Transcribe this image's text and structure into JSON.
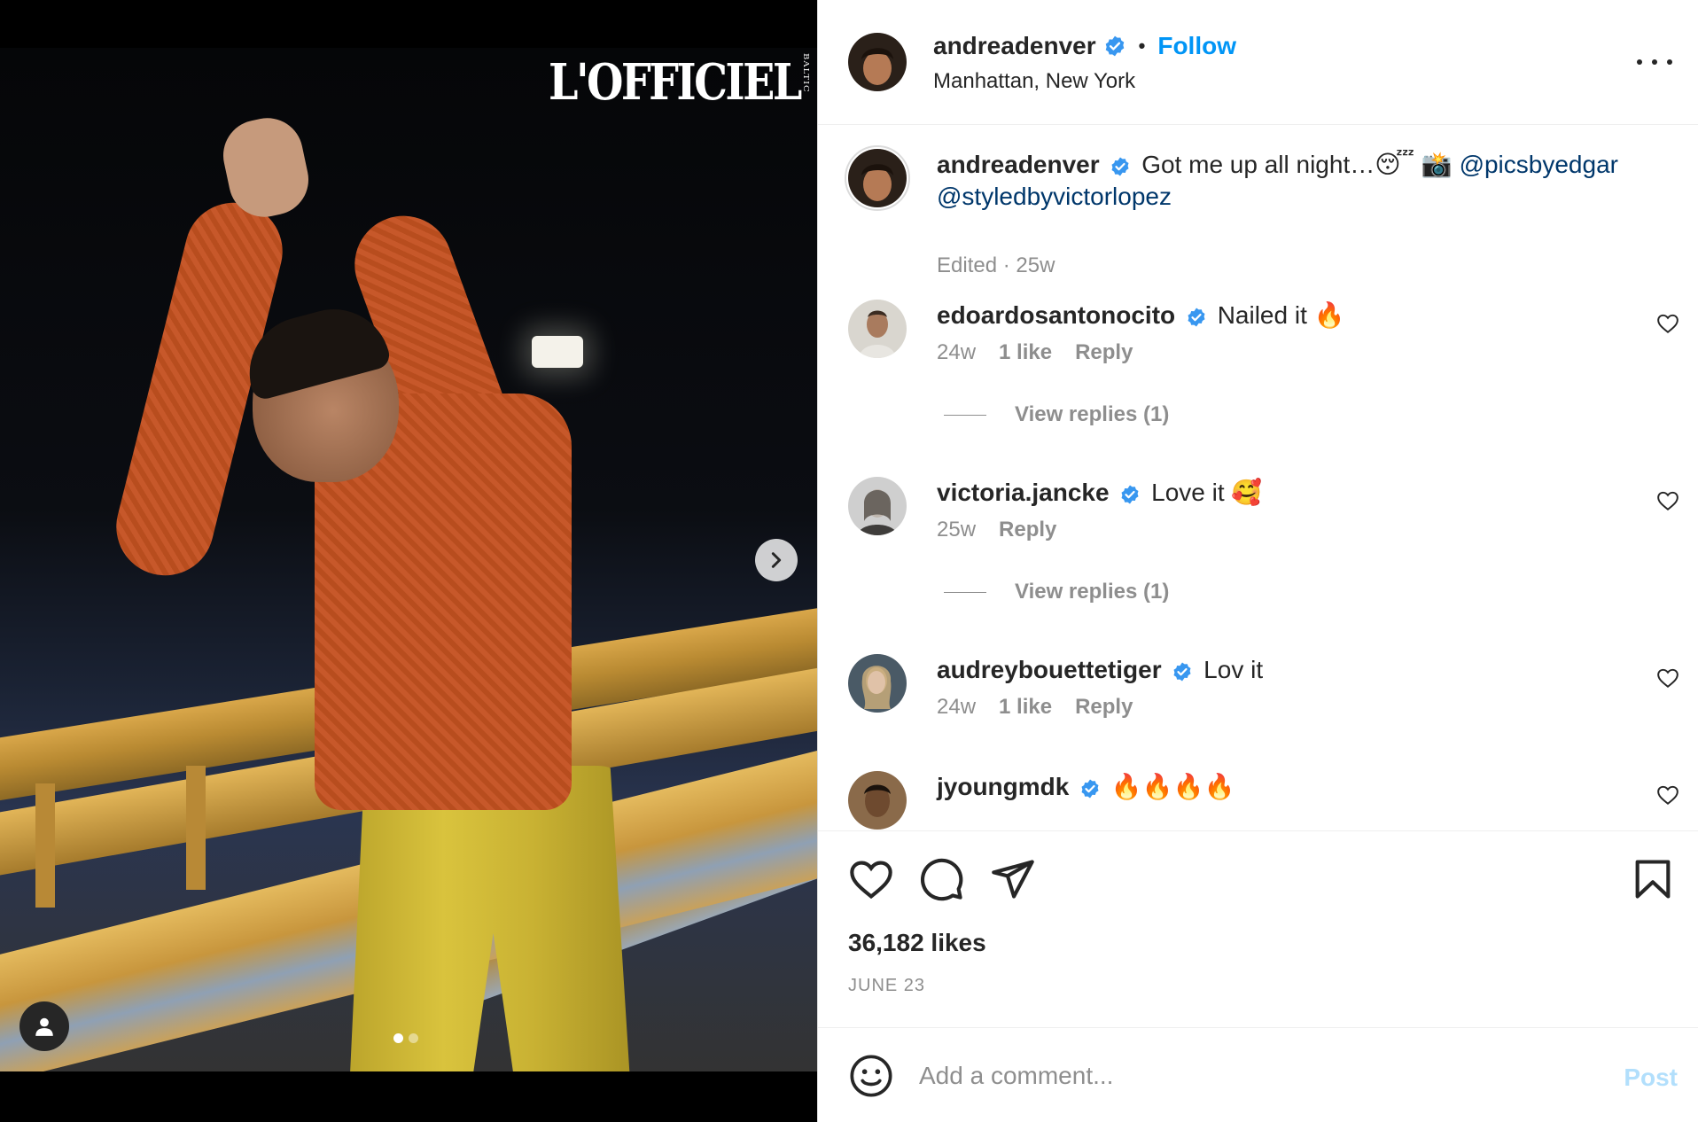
{
  "media": {
    "logo_text": "L'OFFICIEL",
    "logo_subtext": "BALTIC",
    "carousel": {
      "total": 2,
      "current": 1
    },
    "icons": {
      "next": "chevron-right-icon",
      "tags": "user-tag-icon"
    }
  },
  "header": {
    "username": "andreadenver",
    "separator": "•",
    "follow_label": "Follow",
    "location": "Manhattan, New York"
  },
  "caption": {
    "username": "andreadenver",
    "text": "Got me up all night…😴 📸 ",
    "mention1": "@picsbyedgar",
    "mention2": "@styledbyvictorlopez",
    "meta": "Edited · 25w"
  },
  "comments": [
    {
      "username": "edoardosantonocito",
      "text": "Nailed it 🔥",
      "time": "24w",
      "likes": "1 like",
      "reply": "Reply",
      "view_replies": "View replies (1)"
    },
    {
      "username": "victoria.jancke",
      "text": "Love it 🥰",
      "time": "25w",
      "likes": "",
      "reply": "Reply",
      "view_replies": "View replies (1)"
    },
    {
      "username": "audreybouettetiger",
      "text": "Lov it",
      "time": "24w",
      "likes": "1 like",
      "reply": "Reply",
      "view_replies": ""
    },
    {
      "username": "jyoungmdk",
      "text": "🔥🔥🔥🔥",
      "time": "",
      "likes": "",
      "reply": "",
      "view_replies": ""
    }
  ],
  "actions": {
    "likes": "36,182 likes",
    "date": "JUNE 23",
    "icons": [
      "heart-icon",
      "comment-icon",
      "share-icon",
      "bookmark-icon"
    ]
  },
  "add_comment": {
    "placeholder": "Add a comment...",
    "post_label": "Post"
  },
  "colors": {
    "accent": "#0095f6",
    "verified": "#3897f0",
    "mention": "#00376b",
    "muted": "#8e8e8e",
    "post_disabled": "#b2dffc"
  }
}
